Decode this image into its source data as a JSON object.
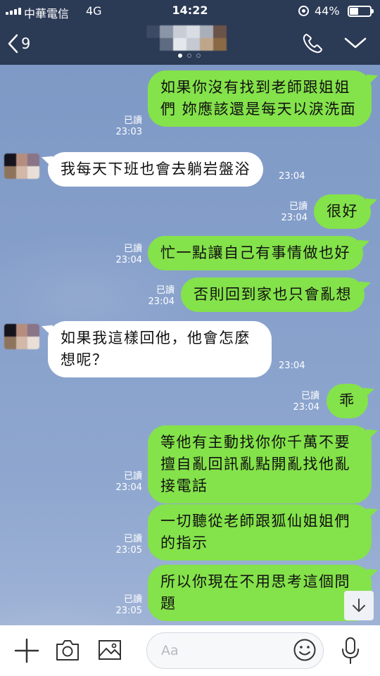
{
  "status_bar": {
    "carrier": "中華電信",
    "network": "4G",
    "time": "14:22",
    "battery": "44%"
  },
  "header": {
    "back_count": "9"
  },
  "messages": [
    {
      "side": "out",
      "text": "如果你沒有找到老師跟姐姐們 妳應該還是每天以淚洗面",
      "read": "已讀",
      "time": "23:03"
    },
    {
      "side": "in",
      "text": "我每天下班也會去躺岩盤浴",
      "time": "23:04"
    },
    {
      "side": "out",
      "text": "很好",
      "read": "已讀",
      "time": "23:04"
    },
    {
      "side": "out",
      "text": "忙一點讓自己有事情做也好",
      "read": "已讀",
      "time": "23:04"
    },
    {
      "side": "out",
      "text": "否則回到家也只會亂想",
      "read": "已讀",
      "time": "23:04"
    },
    {
      "side": "in",
      "text": "如果我這樣回他，他會怎麼想呢？",
      "time": "23:04"
    },
    {
      "side": "out",
      "text": "乖",
      "read": "已讀",
      "time": "23:04"
    },
    {
      "side": "out",
      "text": "等他有主動找你你千萬不要擅自亂回訊亂點開亂找他亂接電話",
      "read": "已讀",
      "time": "23:04"
    },
    {
      "side": "out",
      "text": "一切聽從老師跟狐仙姐姐們的指示",
      "read": "已讀",
      "time": "23:05"
    },
    {
      "side": "out",
      "text": "所以你現在不用思考這個問題",
      "read": "已讀",
      "time": "23:05"
    }
  ],
  "input": {
    "placeholder": "Aa"
  },
  "colors": {
    "header_bg": "#2b3a55",
    "outgoing_bubble": "#84e24a",
    "incoming_bubble": "#ffffff",
    "chat_bg": "#86a0cb"
  },
  "icons": [
    "signal-icon",
    "lock-rotation-icon",
    "battery-icon",
    "back-chevron-icon",
    "phone-icon",
    "chevron-down-icon",
    "plus-icon",
    "camera-icon",
    "image-icon",
    "emoji-icon",
    "microphone-icon",
    "scroll-down-arrow-icon"
  ]
}
